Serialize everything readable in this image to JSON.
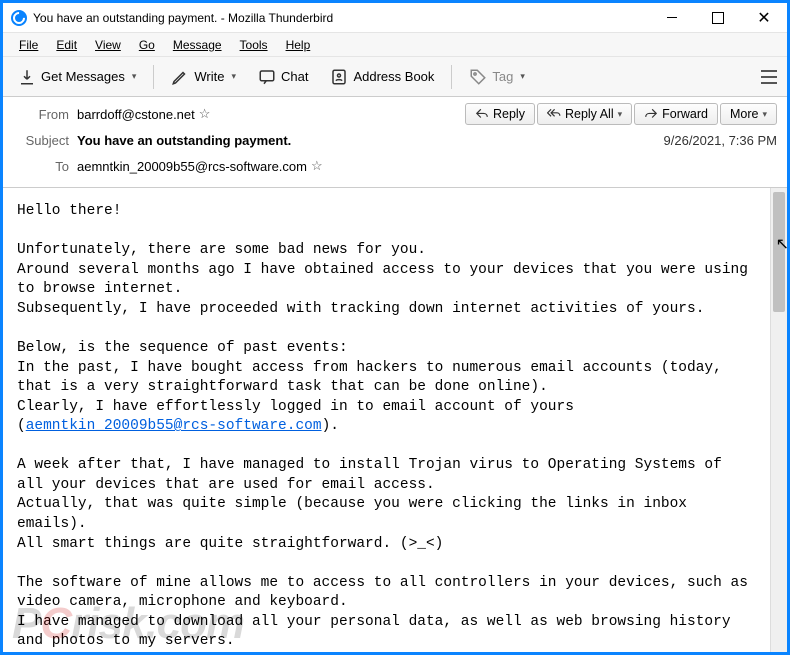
{
  "titlebar": {
    "title": "You have an outstanding payment. - Mozilla Thunderbird"
  },
  "menubar": {
    "file": "File",
    "edit": "Edit",
    "view": "View",
    "go": "Go",
    "message": "Message",
    "tools": "Tools",
    "help": "Help"
  },
  "toolbar": {
    "get_messages": "Get Messages",
    "write": "Write",
    "chat": "Chat",
    "address_book": "Address Book",
    "tag": "Tag"
  },
  "header": {
    "from_label": "From",
    "from_value": "barrdoff@cstone.net",
    "subject_label": "Subject",
    "subject_value": "You have an outstanding payment.",
    "to_label": "To",
    "to_value": "aemntkin_20009b55@rcs-software.com",
    "date": "9/26/2021, 7:36 PM",
    "reply": "Reply",
    "reply_all": "Reply All",
    "forward": "Forward",
    "more": "More"
  },
  "body": {
    "greeting": "Hello there!",
    "p1": "Unfortunately, there are some bad news for you.\nAround several months ago I have obtained access to your devices that you were using to browse internet.\nSubsequently, I have proceeded with tracking down internet activities of yours.",
    "p2a": "Below, is the sequence of past events:\nIn the past, I have bought access from hackers to numerous email accounts (today, that is a very straightforward task that can be done online).\nClearly, I have effortlessly logged in to email account of yours (",
    "email_link": "aemntkin_20009b55@rcs-software.com",
    "p2b": ").",
    "p3": "A week after that, I have managed to install Trojan virus to Operating Systems of all your devices that are used for email access.\nActually, that was quite simple (because you were clicking the links in inbox emails).\nAll smart things are quite straightforward. (>_<)",
    "p4": "The software of mine allows me to access to all controllers in your devices, such as video camera, microphone and keyboard.\nI have managed to download all your personal data, as well as web browsing history and photos to my servers."
  },
  "watermark": {
    "p": "P",
    "c": "C",
    "rest": "risk.com"
  }
}
